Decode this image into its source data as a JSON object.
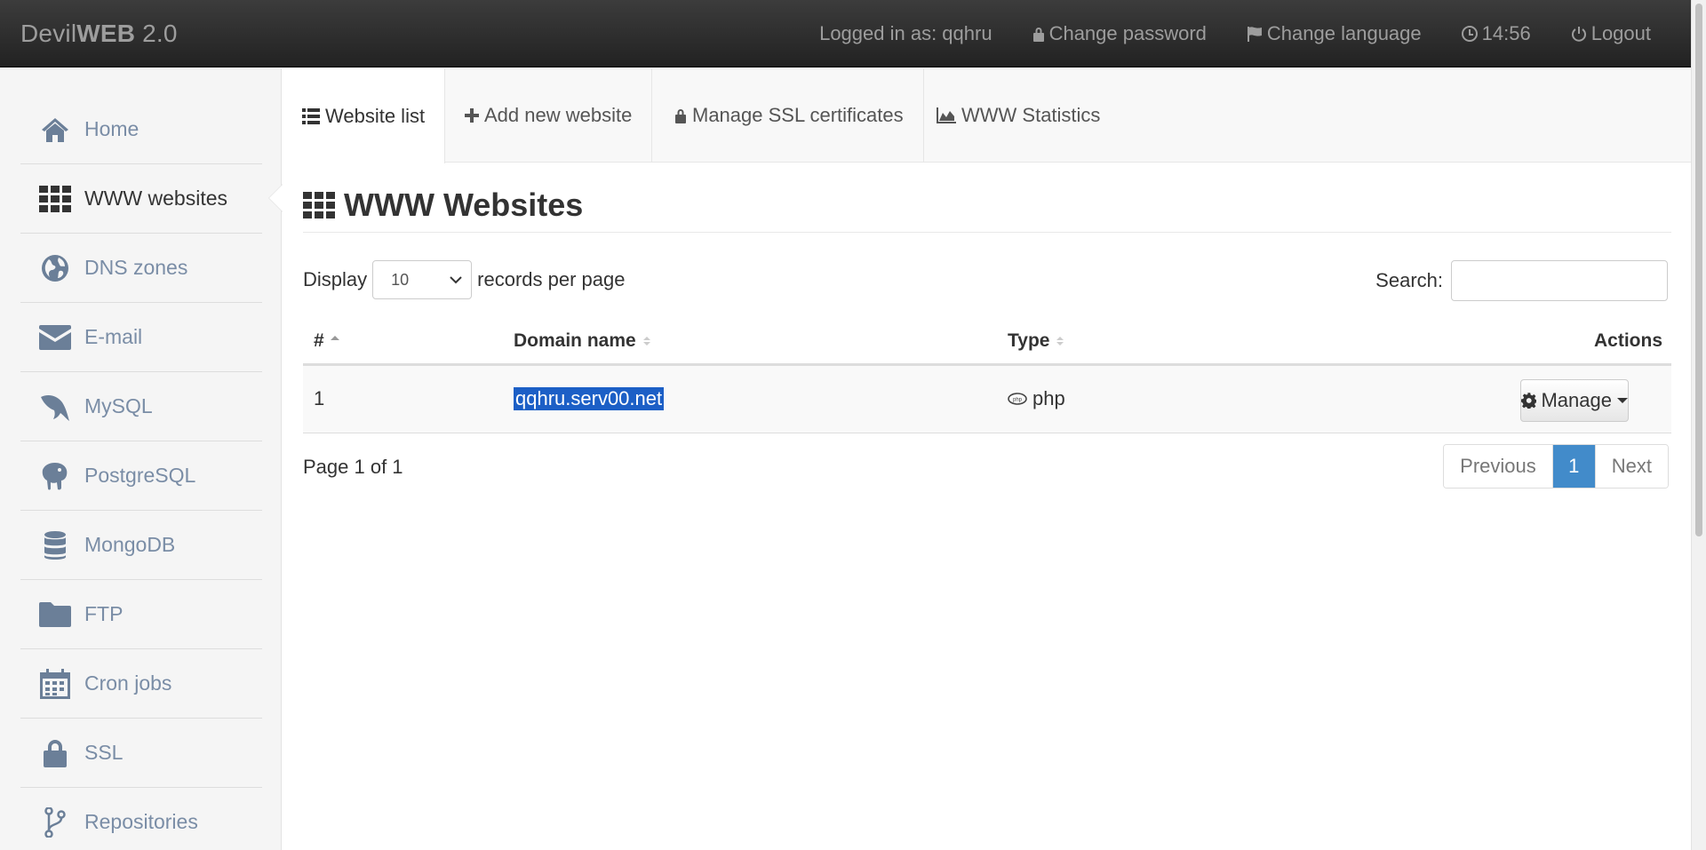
{
  "navbar": {
    "brand_regular": "Devil",
    "brand_bold": "WEB",
    "brand_version": " 2.0",
    "logged_in": "Logged in as: qqhru",
    "change_password": "Change password",
    "change_language": "Change language",
    "time": "14:56",
    "logout": "Logout"
  },
  "sidebar": {
    "items": [
      {
        "label": "Home",
        "icon": "home-icon"
      },
      {
        "label": "WWW websites",
        "icon": "grid-icon"
      },
      {
        "label": "DNS zones",
        "icon": "globe-icon"
      },
      {
        "label": "E-mail",
        "icon": "envelope-icon"
      },
      {
        "label": "MySQL",
        "icon": "dolphin-icon"
      },
      {
        "label": "PostgreSQL",
        "icon": "elephant-icon"
      },
      {
        "label": "MongoDB",
        "icon": "database-icon"
      },
      {
        "label": "FTP",
        "icon": "folder-icon"
      },
      {
        "label": "Cron jobs",
        "icon": "calendar-icon"
      },
      {
        "label": "SSL",
        "icon": "lock-icon"
      },
      {
        "label": "Repositories",
        "icon": "branch-icon"
      }
    ]
  },
  "tabs": [
    {
      "label": "Website list",
      "icon": "list-icon"
    },
    {
      "label": "Add new website",
      "icon": "plus-icon"
    },
    {
      "label": "Manage SSL certificates",
      "icon": "lock-icon"
    },
    {
      "label": "WWW Statistics",
      "icon": "area-chart-icon"
    }
  ],
  "main": {
    "title": "WWW Websites",
    "display_label": "Display",
    "per_page_value": "10",
    "records_label": "records per page",
    "search_label": "Search:",
    "search_value": "",
    "columns": [
      "#",
      "Domain name",
      "Type",
      "Actions"
    ],
    "rows": [
      {
        "num": "1",
        "domain": "qqhru.serv00.net",
        "type": "php",
        "action": "Manage"
      }
    ],
    "page_info": "Page 1 of 1",
    "pager": {
      "previous": "Previous",
      "current": "1",
      "next": "Next"
    }
  },
  "colors": {
    "accent": "#428bca",
    "selection": "#1c5fc6",
    "navbar": "#222222"
  }
}
